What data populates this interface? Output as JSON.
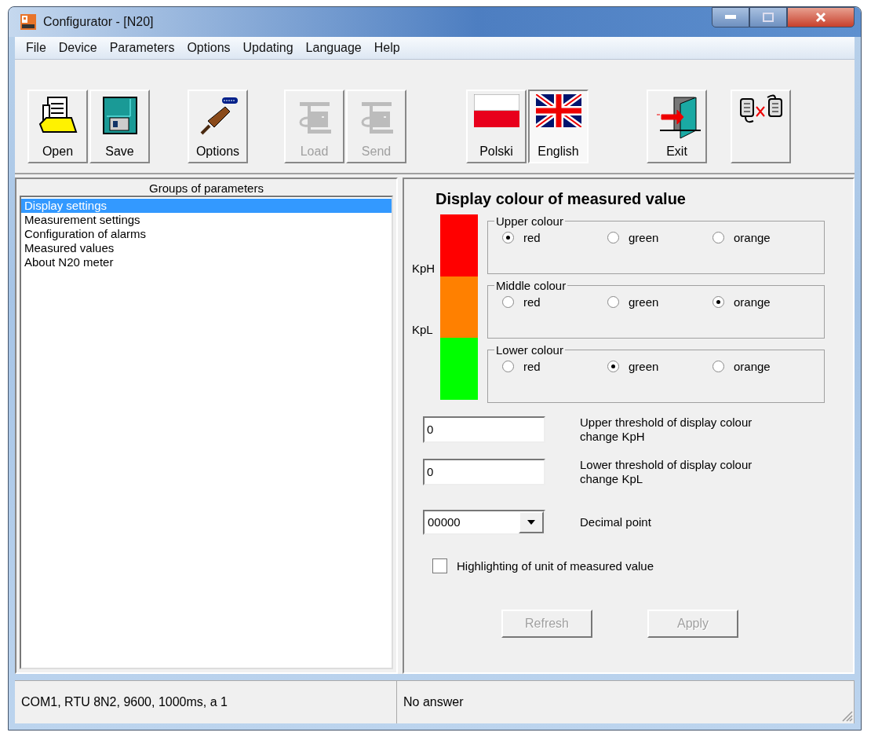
{
  "window": {
    "title": "Configurator - [N20]"
  },
  "menu": [
    "File",
    "Device",
    "Parameters",
    "Options",
    "Updating",
    "Language",
    "Help"
  ],
  "toolbar": {
    "groups": [
      {
        "buttons": [
          {
            "kind": "open",
            "label": "Open",
            "disabled": false,
            "pressed": false
          },
          {
            "kind": "save",
            "label": "Save",
            "disabled": false,
            "pressed": false
          }
        ]
      },
      {
        "buttons": [
          {
            "kind": "options",
            "label": "Options",
            "disabled": false,
            "pressed": false
          }
        ]
      },
      {
        "buttons": [
          {
            "kind": "load",
            "label": "Load",
            "disabled": true,
            "pressed": false
          },
          {
            "kind": "send",
            "label": "Send",
            "disabled": true,
            "pressed": false
          }
        ]
      },
      {
        "buttons": [
          {
            "kind": "flag-pl",
            "label": "Polski",
            "disabled": false,
            "pressed": false
          },
          {
            "kind": "flag-en",
            "label": "English",
            "disabled": false,
            "pressed": true
          }
        ]
      },
      {
        "buttons": [
          {
            "kind": "exit",
            "label": "Exit",
            "disabled": false,
            "pressed": false
          }
        ]
      },
      {
        "buttons": [
          {
            "kind": "disconnect",
            "disabled": false,
            "pressed": false
          }
        ]
      }
    ]
  },
  "groups_panel": {
    "title": "Groups of parameters",
    "items": [
      {
        "label": "Display settings",
        "selected": true
      },
      {
        "label": "Measurement settings",
        "selected": false
      },
      {
        "label": "Configuration of alarms",
        "selected": false
      },
      {
        "label": "Measured values",
        "selected": false
      },
      {
        "label": "About N20 meter",
        "selected": false
      }
    ]
  },
  "display": {
    "title": "Display colour of measured value",
    "markers": [
      "KpH",
      "KpL"
    ],
    "bar_segments": [
      {
        "color": "#ff0000"
      },
      {
        "color": "#ff8000"
      },
      {
        "color": "#00ff00"
      }
    ],
    "color_groups": [
      {
        "legend": "Upper colour",
        "options": [
          {
            "label": "red",
            "selected": true
          },
          {
            "label": "green",
            "selected": false
          },
          {
            "label": "orange",
            "selected": false
          }
        ]
      },
      {
        "legend": "Middle colour",
        "options": [
          {
            "label": "red",
            "selected": false
          },
          {
            "label": "green",
            "selected": false
          },
          {
            "label": "orange",
            "selected": true
          }
        ]
      },
      {
        "legend": "Lower colour",
        "options": [
          {
            "label": "red",
            "selected": false
          },
          {
            "label": "green",
            "selected": true
          },
          {
            "label": "orange",
            "selected": false
          }
        ]
      }
    ],
    "fields": [
      {
        "kind": "text",
        "value": "0",
        "label": "Upper threshold of display colour change KpH"
      },
      {
        "kind": "text",
        "value": "0",
        "label": "Lower threshold of display colour change KpL"
      },
      {
        "kind": "dropdown",
        "value": "00000",
        "label": "Decimal point"
      }
    ],
    "checkbox": {
      "label": "Highlighting of unit of measured value",
      "checked": false
    },
    "buttons": [
      {
        "label": "Refresh",
        "disabled": true
      },
      {
        "label": "Apply",
        "disabled": true
      }
    ]
  },
  "status_bar": [
    "COM1, RTU 8N2, 9600, 1000ms, a 1",
    "No answer"
  ]
}
